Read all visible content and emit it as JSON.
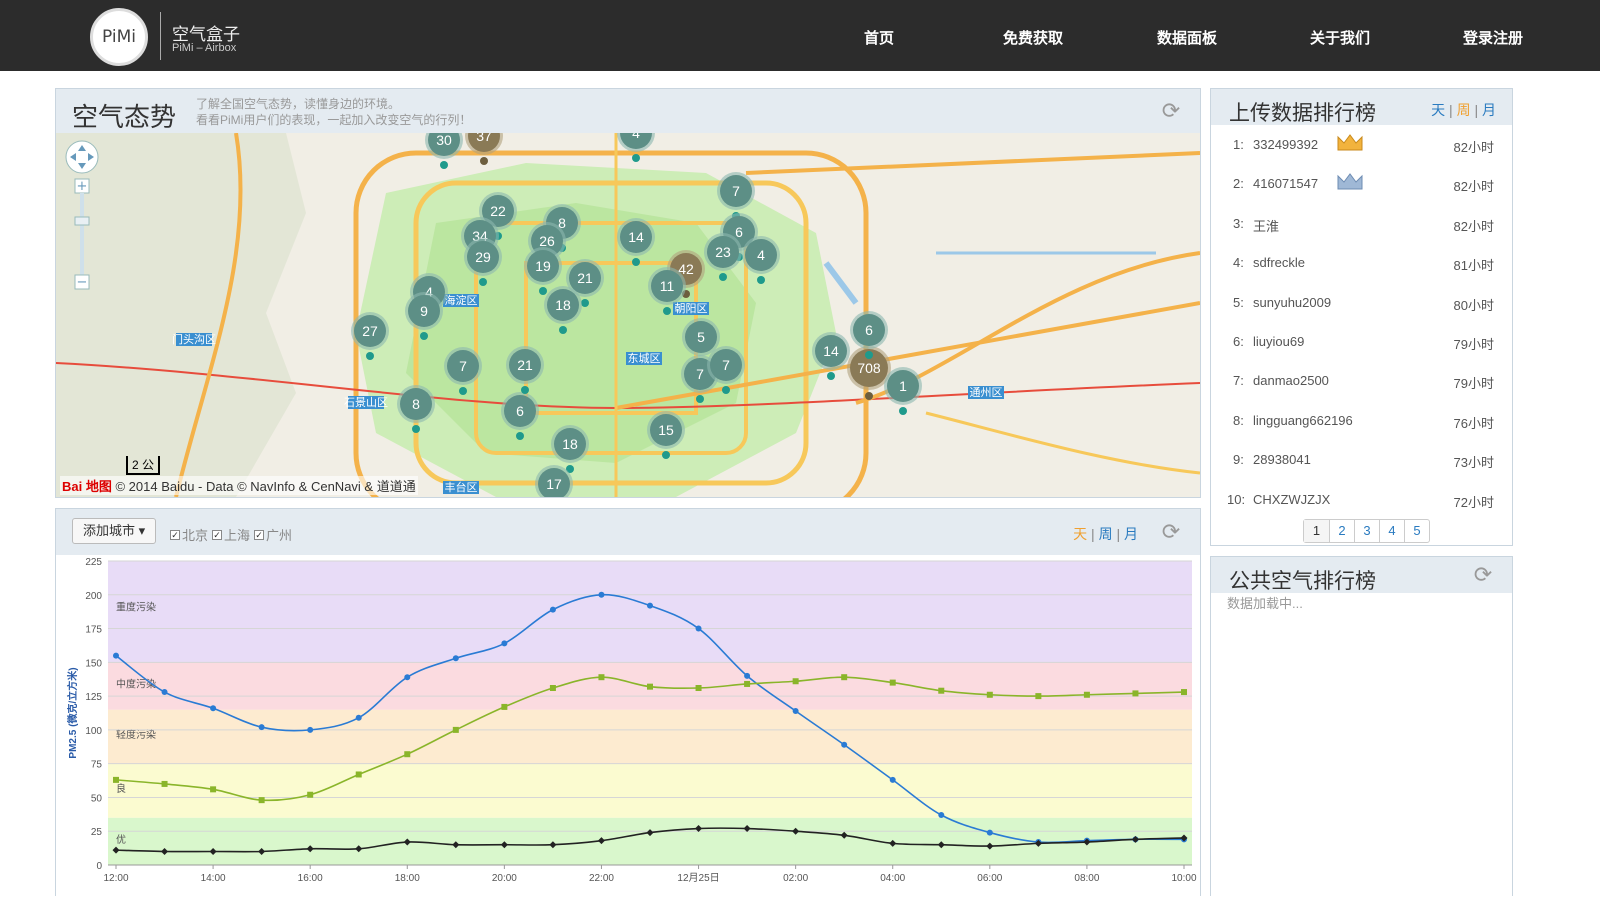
{
  "header": {
    "logo_text": "PiMi",
    "brand_title": "空气盒子",
    "brand_sub": "PiMi – Airbox",
    "nav": [
      "首页",
      "免费获取",
      "数据面板",
      "关于我们",
      "登录注册"
    ]
  },
  "map_panel": {
    "title": "空气态势",
    "desc_line1": "了解全国空气态势，读懂身边的环境。",
    "desc_line2": "看看PiMi用户们的表现，一起加入改变空气的行列！",
    "copyright": "© 2014 Baidu - Data © NavInfo & CenNavi & 道道通",
    "baidu_logo": "Bai 地图",
    "scale": "2 公",
    "districts": [
      "海淀区",
      "朝阳区",
      "东城区",
      "门头沟区",
      "石景山区",
      "通州区",
      "丰台区"
    ],
    "clusters": [
      {
        "label": "30",
        "kind": "teal"
      },
      {
        "label": "37",
        "kind": "brown"
      },
      {
        "label": "4",
        "kind": "teal"
      },
      {
        "label": "7",
        "kind": "teal"
      },
      {
        "label": "22",
        "kind": "teal"
      },
      {
        "label": "8",
        "kind": "teal"
      },
      {
        "label": "34",
        "kind": "teal"
      },
      {
        "label": "26",
        "kind": "teal"
      },
      {
        "label": "14",
        "kind": "teal"
      },
      {
        "label": "6",
        "kind": "teal"
      },
      {
        "label": "29",
        "kind": "teal"
      },
      {
        "label": "19",
        "kind": "teal"
      },
      {
        "label": "42",
        "kind": "brown"
      },
      {
        "label": "23",
        "kind": "teal"
      },
      {
        "label": "4",
        "kind": "teal"
      },
      {
        "label": "21",
        "kind": "teal"
      },
      {
        "label": "11",
        "kind": "teal"
      },
      {
        "label": "4",
        "kind": "teal"
      },
      {
        "label": "18",
        "kind": "teal"
      },
      {
        "label": "9",
        "kind": "teal"
      },
      {
        "label": "27",
        "kind": "teal"
      },
      {
        "label": "5",
        "kind": "teal"
      },
      {
        "label": "6",
        "kind": "teal"
      },
      {
        "label": "7",
        "kind": "teal"
      },
      {
        "label": "21",
        "kind": "teal"
      },
      {
        "label": "7",
        "kind": "teal"
      },
      {
        "label": "7",
        "kind": "teal"
      },
      {
        "label": "14",
        "kind": "teal"
      },
      {
        "label": "708",
        "kind": "brown"
      },
      {
        "label": "1",
        "kind": "teal"
      },
      {
        "label": "8",
        "kind": "teal"
      },
      {
        "label": "6",
        "kind": "teal"
      },
      {
        "label": "15",
        "kind": "teal"
      },
      {
        "label": "18",
        "kind": "teal"
      },
      {
        "label": "17",
        "kind": "teal"
      }
    ]
  },
  "chart_panel": {
    "add_city": "添加城市 ▾",
    "cities": [
      "北京",
      "上海",
      "广州"
    ],
    "range": {
      "day": "天",
      "week": "周",
      "month": "月",
      "sep": "|"
    }
  },
  "chart_data": {
    "type": "line",
    "ylabel": "PM2.5 (微克/立方米)",
    "ylim": [
      0,
      225
    ],
    "yticks": [
      0,
      25,
      50,
      75,
      100,
      125,
      150,
      175,
      200,
      225
    ],
    "x_tick_labels": [
      "12:00",
      "14:00",
      "16:00",
      "18:00",
      "20:00",
      "22:00",
      "12月25日",
      "02:00",
      "04:00",
      "06:00",
      "08:00",
      "10:00"
    ],
    "x_points": [
      0,
      1,
      2,
      3,
      4,
      5,
      6,
      7,
      8,
      9,
      10,
      11,
      12,
      13,
      14,
      15,
      16,
      17,
      18,
      19,
      20,
      21,
      22
    ],
    "bands": [
      {
        "label": "优",
        "from": 0,
        "to": 35,
        "color": "#d9f7cc"
      },
      {
        "label": "良",
        "from": 35,
        "to": 75,
        "color": "#fbfbd0"
      },
      {
        "label": "轻度污染",
        "from": 75,
        "to": 115,
        "color": "#fdebd0"
      },
      {
        "label": "中度污染",
        "from": 115,
        "to": 150,
        "color": "#fbdbe0"
      },
      {
        "label": "重度污染",
        "from": 150,
        "to": 225,
        "color": "#e8dcf7"
      }
    ],
    "series": [
      {
        "color": "#2a7bd4",
        "marker": "circle",
        "values": [
          155,
          128,
          116,
          102,
          100,
          109,
          139,
          153,
          164,
          189,
          200,
          192,
          175,
          140,
          114,
          89,
          63,
          37,
          24,
          17,
          18,
          19,
          19
        ]
      },
      {
        "color": "#8ab52a",
        "marker": "square",
        "values": [
          63,
          60,
          56,
          48,
          52,
          67,
          82,
          100,
          117,
          131,
          139,
          132,
          131,
          134,
          136,
          139,
          135,
          129,
          126,
          125,
          126,
          127,
          128
        ]
      },
      {
        "color": "#222222",
        "marker": "diamond",
        "values": [
          11,
          10,
          10,
          10,
          12,
          12,
          17,
          15,
          15,
          15,
          18,
          24,
          27,
          27,
          25,
          22,
          16,
          15,
          14,
          16,
          17,
          19,
          20
        ]
      }
    ]
  },
  "upload_rank": {
    "title": "上传数据排行榜",
    "range": {
      "day": "天",
      "week": "周",
      "month": "月",
      "sep": "|"
    },
    "rows": [
      {
        "idx": "1:",
        "name": "332499392",
        "hours": "82小时",
        "badge": "gold-crown-icon"
      },
      {
        "idx": "2:",
        "name": "416071547",
        "hours": "82小时",
        "badge": "silver-crown-icon"
      },
      {
        "idx": "3:",
        "name": "王淮",
        "hours": "82小时",
        "badge": ""
      },
      {
        "idx": "4:",
        "name": "sdfreckle",
        "hours": "81小时",
        "badge": ""
      },
      {
        "idx": "5:",
        "name": "sunyuhu2009",
        "hours": "80小时",
        "badge": ""
      },
      {
        "idx": "6:",
        "name": "liuyiou69",
        "hours": "79小时",
        "badge": ""
      },
      {
        "idx": "7:",
        "name": "danmao2500",
        "hours": "79小时",
        "badge": ""
      },
      {
        "idx": "8:",
        "name": "lingguang662196",
        "hours": "76小时",
        "badge": ""
      },
      {
        "idx": "9:",
        "name": "28938041",
        "hours": "73小时",
        "badge": ""
      },
      {
        "idx": "10:",
        "name": "CHXZWJZJX",
        "hours": "72小时",
        "badge": ""
      }
    ],
    "pages": [
      "1",
      "2",
      "3",
      "4",
      "5"
    ]
  },
  "public_rank": {
    "title": "公共空气排行榜",
    "loading": "数据加载中..."
  },
  "colors": {
    "topbar": "#2c2c2c",
    "panel_head": "#e4ebf1",
    "link_blue": "#2a7bc0",
    "active_orange": "#f0a030"
  }
}
